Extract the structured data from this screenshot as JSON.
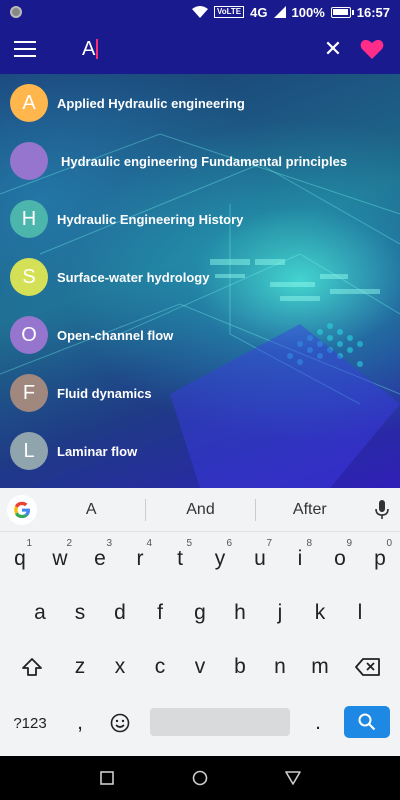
{
  "status": {
    "time": "16:57",
    "battery": "100%",
    "network": "4G",
    "volte": "VoLTE"
  },
  "search": {
    "query": "A"
  },
  "list": [
    {
      "letter": "A",
      "label": "Applied Hydraulic engineering",
      "color": "#ffb74d"
    },
    {
      "letter": "",
      "label": "Hydraulic engineering Fundamental principles",
      "color": "#9575cd"
    },
    {
      "letter": "H",
      "label": "Hydraulic Engineering  History",
      "color": "#4db6ac"
    },
    {
      "letter": "S",
      "label": "Surface-water hydrology",
      "color": "#d4e157"
    },
    {
      "letter": "O",
      "label": "Open-channel flow",
      "color": "#9575cd"
    },
    {
      "letter": "F",
      "label": "Fluid dynamics",
      "color": "#a1887f"
    },
    {
      "letter": "L",
      "label": "Laminar flow",
      "color": "#90a4ae"
    }
  ],
  "keyboard": {
    "suggestions": [
      "A",
      "And",
      "After"
    ],
    "row1": [
      {
        "k": "q",
        "n": "1"
      },
      {
        "k": "w",
        "n": "2"
      },
      {
        "k": "e",
        "n": "3"
      },
      {
        "k": "r",
        "n": "4"
      },
      {
        "k": "t",
        "n": "5"
      },
      {
        "k": "y",
        "n": "6"
      },
      {
        "k": "u",
        "n": "7"
      },
      {
        "k": "i",
        "n": "8"
      },
      {
        "k": "o",
        "n": "9"
      },
      {
        "k": "p",
        "n": "0"
      }
    ],
    "row2": [
      "a",
      "s",
      "d",
      "f",
      "g",
      "h",
      "j",
      "k",
      "l"
    ],
    "row3": [
      "z",
      "x",
      "c",
      "v",
      "b",
      "n",
      "m"
    ],
    "symbols_label": "?123",
    "comma": ",",
    "period": "."
  }
}
